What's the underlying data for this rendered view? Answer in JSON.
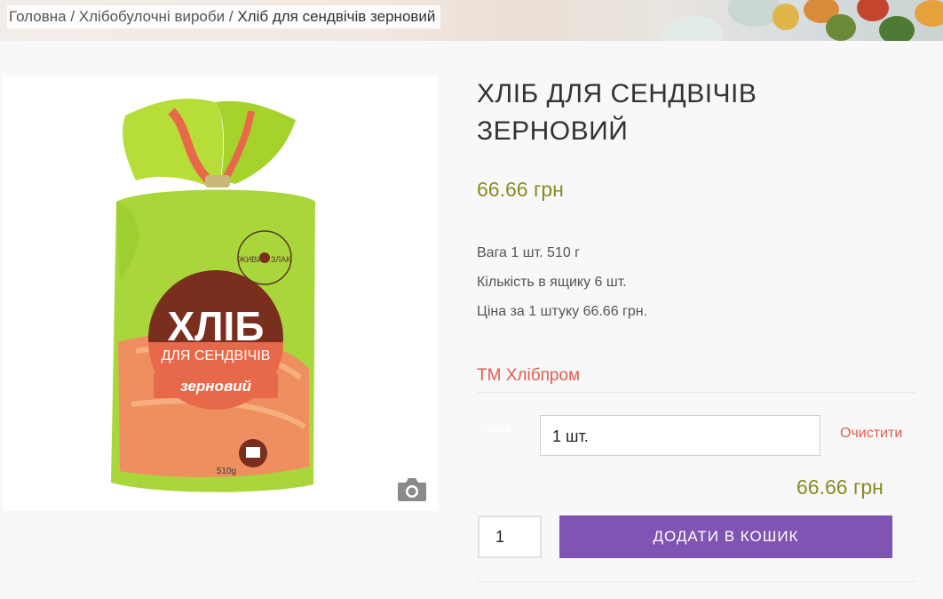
{
  "breadcrumb": {
    "home": "Головна",
    "category": "Хлібобулочні вироби",
    "separator": "/",
    "current": "Хліб для сендвічів зерновий"
  },
  "product": {
    "title": "ХЛІБ ДЛЯ СЕНДВІЧІВ ЗЕРНОВИЙ",
    "price": "66.66 грн",
    "description": [
      "Вага 1 шт. 510 г",
      "Кількість в ящику 6 шт.",
      "Ціна за 1 штуку 66.66 грн."
    ],
    "brand": "ТМ Хлібпром",
    "package": {
      "logo_text": "ЖИВИЙ ЗЛАК",
      "big_title": "ХЛІБ",
      "subtitle": "ДЛЯ СЕНДВІЧІВ",
      "variant": "зерновий",
      "weight": "510g"
    }
  },
  "variation": {
    "label": "вага",
    "selected": "1 шт.",
    "reset_label": "Очистити",
    "price": "66.66 грн"
  },
  "cart": {
    "quantity": "1",
    "button_label": "ДОДАТИ В КОШИК"
  },
  "colors": {
    "button": "#7f54b3",
    "price": "#8a8a24",
    "brand_link": "#e25c4e",
    "package_green": "#a9d63a",
    "package_label": "#7a2e1e"
  }
}
